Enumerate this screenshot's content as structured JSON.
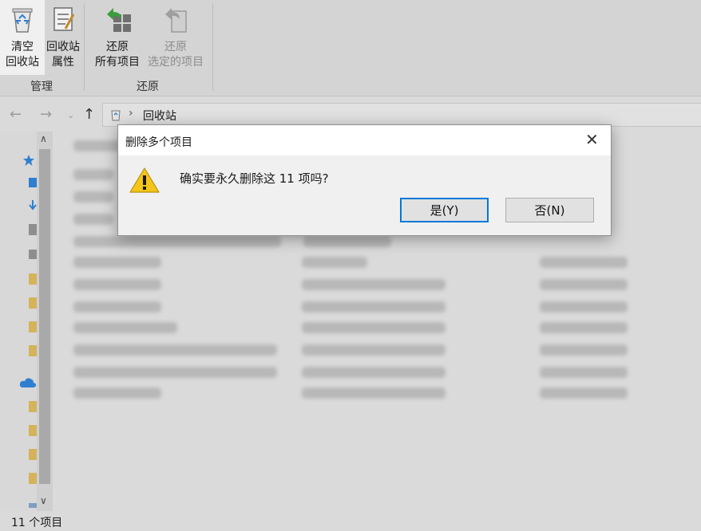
{
  "ribbon": {
    "empty_line1": "清空",
    "empty_line2": "回收站",
    "props_line1": "回收站",
    "props_line2": "属性",
    "restore_all_line1": "还原",
    "restore_all_line2": "所有项目",
    "restore_sel_line1": "还原",
    "restore_sel_line2": "选定的项目",
    "group_manage": "管理",
    "group_restore": "还原"
  },
  "address": {
    "location": "回收站",
    "separator": "›"
  },
  "status": {
    "item_count": "11 个项目"
  },
  "dialog": {
    "title": "删除多个项目",
    "message": "确实要永久删除这 11 项吗?",
    "yes_label": "是(Y)",
    "no_label": "否(N)",
    "close_glyph": "✕"
  }
}
